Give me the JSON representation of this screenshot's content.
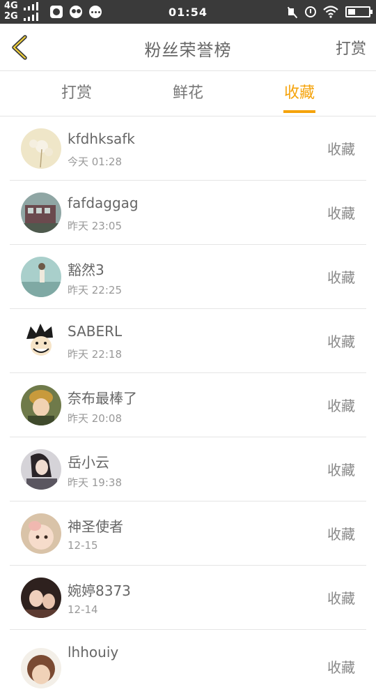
{
  "status_bar": {
    "net_top": "4G",
    "net_bottom": "2G",
    "time": "01:54",
    "battery_level": 0.35,
    "icons": [
      "app-icon",
      "wechat-icon",
      "message-icon",
      "mute-icon",
      "alarm-icon",
      "wifi-icon",
      "battery-icon"
    ]
  },
  "header": {
    "title": "粉丝荣誉榜",
    "right_link": "打赏",
    "back_icon": "chevron-left-icon"
  },
  "tabs": [
    {
      "label": "打赏",
      "active": false
    },
    {
      "label": "鲜花",
      "active": false
    },
    {
      "label": "收藏",
      "active": true
    }
  ],
  "accent_color": "#f5a30b",
  "list": [
    {
      "name": "kfdhksafk",
      "time": "今天 01:28",
      "action": "收藏",
      "avatar_color": "#e8dcb8"
    },
    {
      "name": "fafdaggag",
      "time": "昨天 23:05",
      "action": "收藏",
      "avatar_color": "#6d5a5a"
    },
    {
      "name": "豁然3",
      "time": "昨天 22:25",
      "action": "收藏",
      "avatar_color": "#9fc3c1"
    },
    {
      "name": "SABERL",
      "time": "昨天 22:18",
      "action": "收藏",
      "avatar_color": "#f3efe6"
    },
    {
      "name": "奈布最棒了",
      "time": "昨天 20:08",
      "action": "收藏",
      "avatar_color": "#7a8a4a"
    },
    {
      "name": "岳小云",
      "time": "昨天 19:38",
      "action": "收藏",
      "avatar_color": "#6a6670"
    },
    {
      "name": "神圣使者",
      "time": "12-15",
      "action": "收藏",
      "avatar_color": "#e7c9b0"
    },
    {
      "name": "婉婷8373",
      "time": "12-14",
      "action": "收藏",
      "avatar_color": "#3d2c28"
    },
    {
      "name": "lhhouiy",
      "time": "",
      "action": "收藏",
      "avatar_color": "#8a5a40"
    }
  ]
}
